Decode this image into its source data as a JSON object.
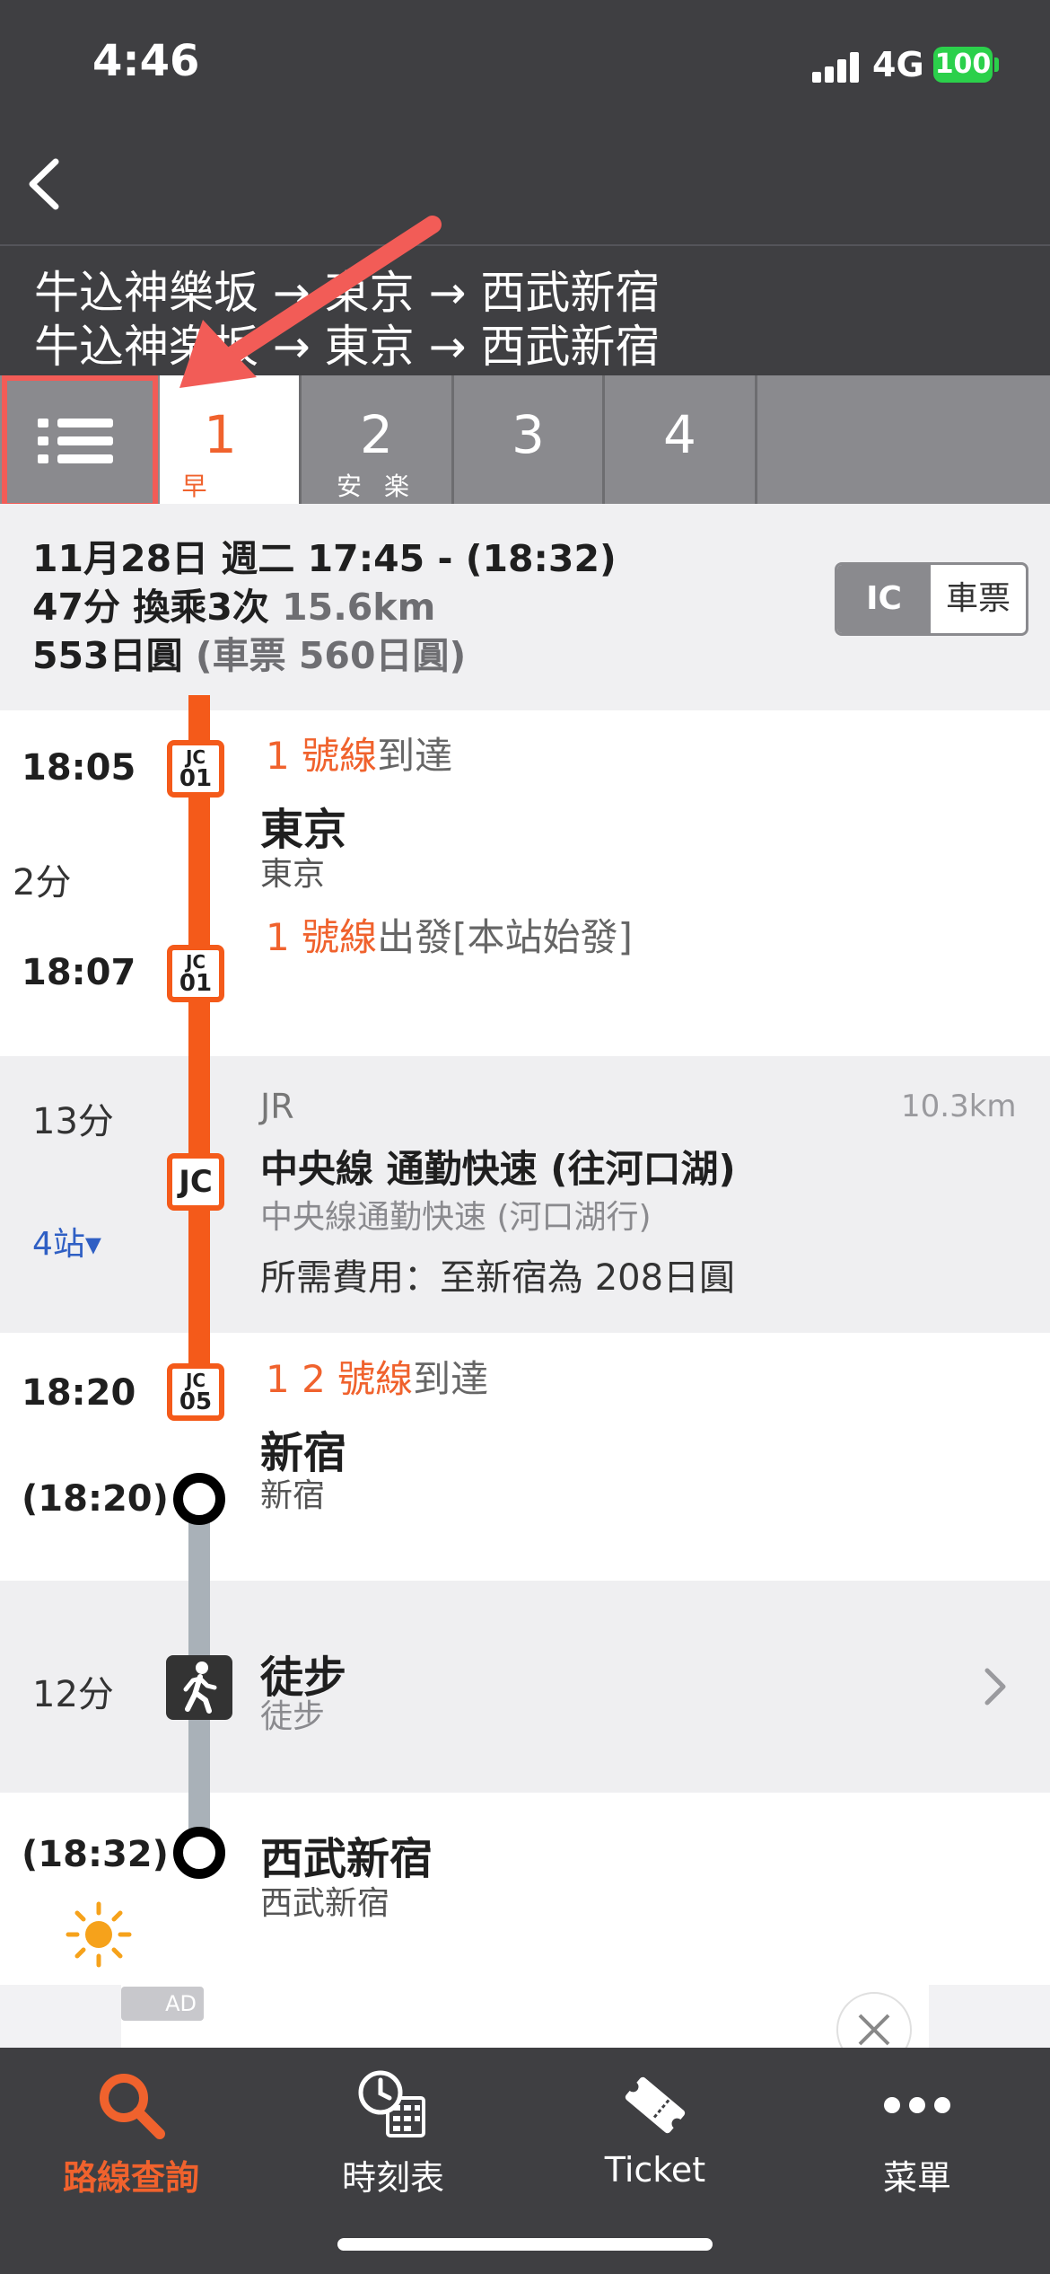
{
  "status_bar": {
    "time": "4:46",
    "network": "4G",
    "battery": "100"
  },
  "header": {
    "route_line_1": "牛込神樂坂 → 東京 → 西武新宿",
    "route_line_2": "牛込神楽坂 → 東京 → 西武新宿"
  },
  "tabs": [
    {
      "num": "1",
      "sub": "早",
      "active": true
    },
    {
      "num": "2",
      "sub": "安 楽",
      "active": false
    },
    {
      "num": "3",
      "sub": "",
      "active": false
    },
    {
      "num": "4",
      "sub": "",
      "active": false
    }
  ],
  "summary": {
    "datetime": "11月28日 週二 17:45 - (18:32)",
    "duration_transfers": "47分 換乘3次",
    "distance": "15.6km",
    "fare": "553日圓",
    "ticket_fare": "(車票 560日圓)",
    "toggle_ic": "IC",
    "toggle_ticket": "車票"
  },
  "segments": {
    "tokyo_arrive_time": "18:05",
    "tokyo_arrive_badge": {
      "top": "JC",
      "num": "01"
    },
    "tokyo_arrive_platform_num": "1 號線",
    "tokyo_arrive_platform_text": "到達",
    "tokyo_name": "東京",
    "tokyo_sub": "東京",
    "transfer_wait": "2分",
    "tokyo_depart_platform_num": "1 號線",
    "tokyo_depart_platform_text": "出發[本站始發]",
    "tokyo_depart_time": "18:07",
    "tokyo_depart_badge": {
      "top": "JC",
      "num": "01"
    },
    "ride_duration": "13分",
    "ride_stops": "4站▾",
    "ride_company": "JR",
    "ride_distance": "10.3km",
    "ride_badge": "JC",
    "ride_line": "中央線 通勤快速 (往河口湖)",
    "ride_line_sub": "中央線通勤快速 (河口湖行)",
    "ride_fare": "所需費用：至新宿為 208日圓",
    "shinjuku_arrive_time": "18:20",
    "shinjuku_badge": {
      "top": "JC",
      "num": "05"
    },
    "shinjuku_platform_num": "1 2 號線",
    "shinjuku_platform_text": "到達",
    "shinjuku_name": "新宿",
    "shinjuku_sub": "新宿",
    "shinjuku_walk_start": "(18:20)",
    "walk_duration": "12分",
    "walk_label": "徒步",
    "walk_sub": "徒步",
    "arrive_time": "(18:32)",
    "seibu_name": "西武新宿",
    "seibu_sub": "西武新宿"
  },
  "ad": {
    "label": "AD"
  },
  "bottom_nav": [
    {
      "label": "路線查詢",
      "icon": "search-icon",
      "active": true
    },
    {
      "label": "時刻表",
      "icon": "timetable-icon",
      "active": false
    },
    {
      "label": "Ticket",
      "icon": "ticket-icon",
      "active": false
    },
    {
      "label": "菜單",
      "icon": "more-icon",
      "active": false
    }
  ],
  "colors": {
    "accent": "#f0622d",
    "line_orange": "#f45a1a",
    "header_bg": "#3f3f42",
    "tab_gray": "#8a8a8e",
    "highlight_red": "#f25c57"
  }
}
